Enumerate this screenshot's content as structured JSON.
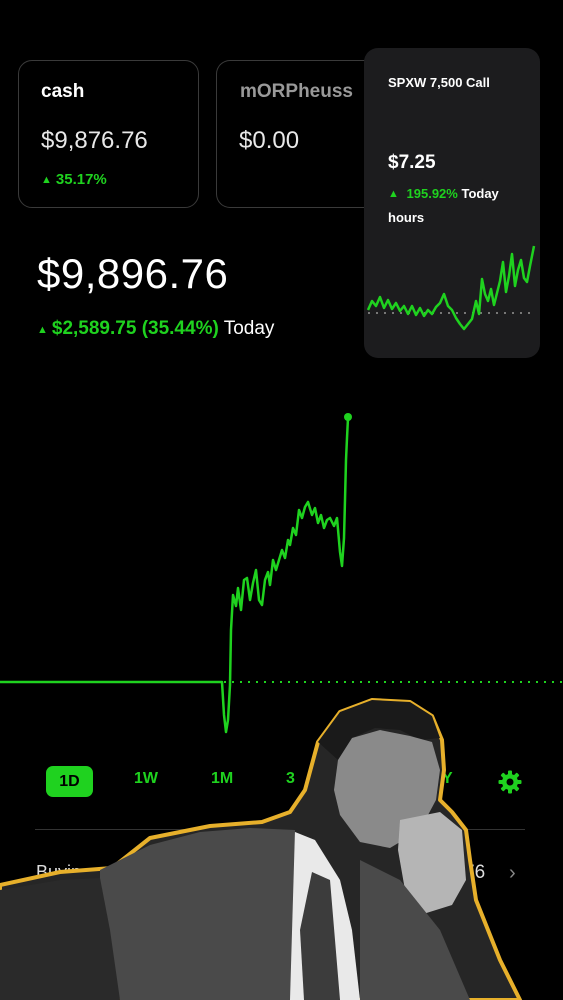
{
  "accounts": [
    {
      "name": "cash",
      "value": "$9,876.76",
      "change": "35.17%"
    },
    {
      "name": "mORPheuss",
      "value": "$0.00"
    }
  ],
  "popup": {
    "title": "SPXW 7,500 Call",
    "price": "$7.25",
    "change_pct": "195.92%",
    "change_suffix": "Today",
    "sub": "hours"
  },
  "portfolio": {
    "balance": "$9,896.76",
    "change_amount": "$2,589.75 (35.44%)",
    "change_suffix": "Today"
  },
  "ranges": {
    "r1d": "1D",
    "r1w": "1W",
    "r1m": "1M",
    "r3m": "3",
    "ry": "Y"
  },
  "buying_power": {
    "label": "Buyin",
    "value": "76"
  },
  "colors": {
    "accent": "#1fd21f",
    "background": "#000000",
    "outline": "#e7b02b"
  },
  "icons": [
    "triangle-up-icon",
    "gear-icon",
    "chevron-right-icon"
  ]
}
